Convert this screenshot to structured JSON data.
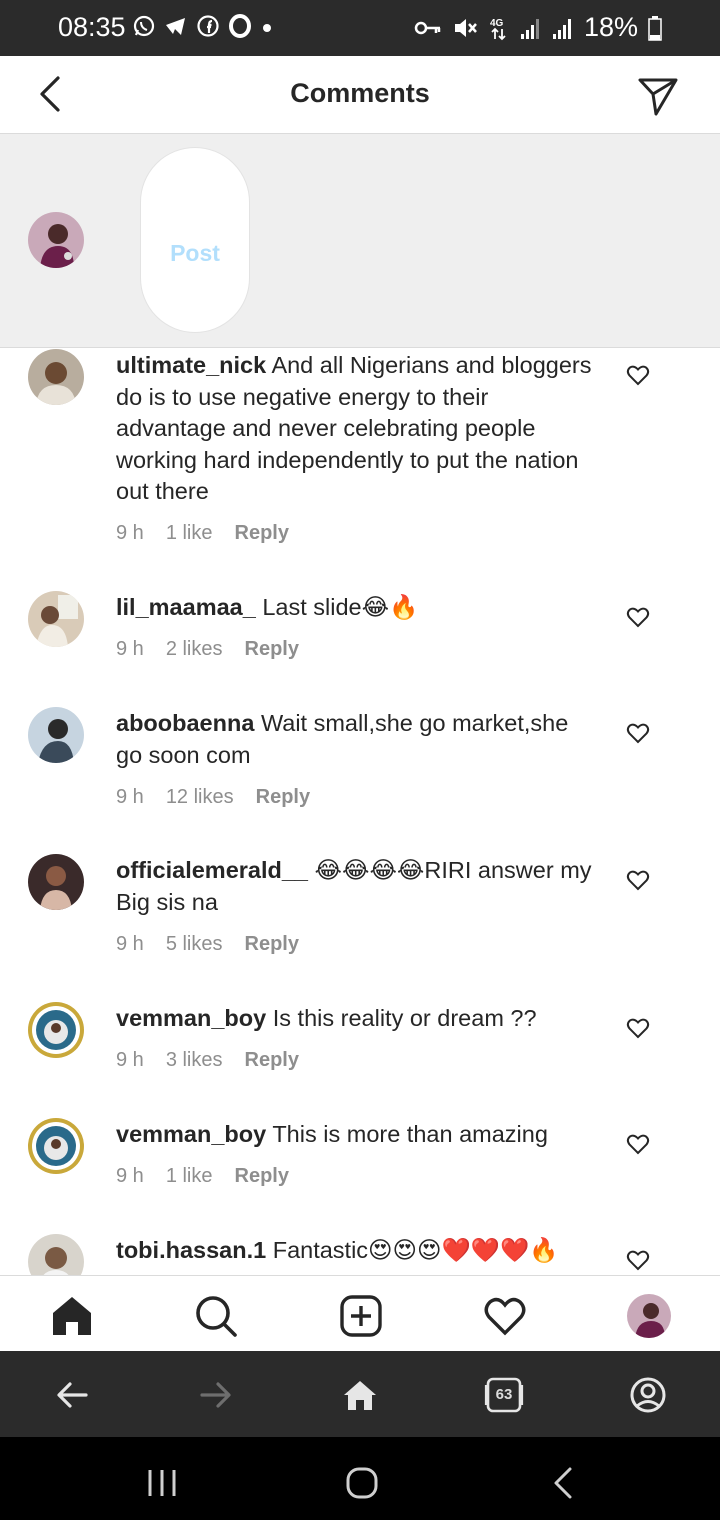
{
  "status_bar": {
    "time": "08:35",
    "battery": "18%",
    "network": "4G"
  },
  "header": {
    "title": "Comments"
  },
  "composer": {
    "post_label": "Post"
  },
  "comments": [
    {
      "username": "ultimate_nick",
      "text": "And all Nigerians and bloggers do is to use negative energy to their advantage and never celebrating people working hard independently to put the nation out there",
      "time": "9 h",
      "likes": "1 like",
      "reply": "Reply"
    },
    {
      "username": "lil_maamaa_",
      "text": "Last slide😂🔥",
      "time": "9 h",
      "likes": "2 likes",
      "reply": "Reply"
    },
    {
      "username": "aboobaenna",
      "text": "Wait small,she go market,she go soon com",
      "time": "9 h",
      "likes": "12 likes",
      "reply": "Reply"
    },
    {
      "username": "officialemerald__",
      "text": "😂😂😂😂RIRI answer my Big sis na",
      "time": "9 h",
      "likes": "5 likes",
      "reply": "Reply"
    },
    {
      "username": "vemman_boy",
      "text": "Is this reality or dream ??",
      "time": "9 h",
      "likes": "3 likes",
      "reply": "Reply"
    },
    {
      "username": "vemman_boy",
      "text": "This is more than amazing",
      "time": "9 h",
      "likes": "1 like",
      "reply": "Reply"
    },
    {
      "username": "tobi.hassan.1",
      "text": "Fantastic😍😍😍❤️❤️❤️🔥",
      "time": "",
      "likes": "",
      "reply": ""
    }
  ],
  "browser": {
    "tab_count": "63"
  },
  "icons": {
    "back": "chevron-left-icon",
    "send": "paper-plane-icon",
    "home": "home-icon",
    "search": "search-icon",
    "new_post": "plus-square-icon",
    "activity": "heart-icon",
    "profile": "avatar"
  },
  "colors": {
    "accent_light": "#b2dffc",
    "text": "#262626",
    "muted": "#8e8e8e"
  }
}
